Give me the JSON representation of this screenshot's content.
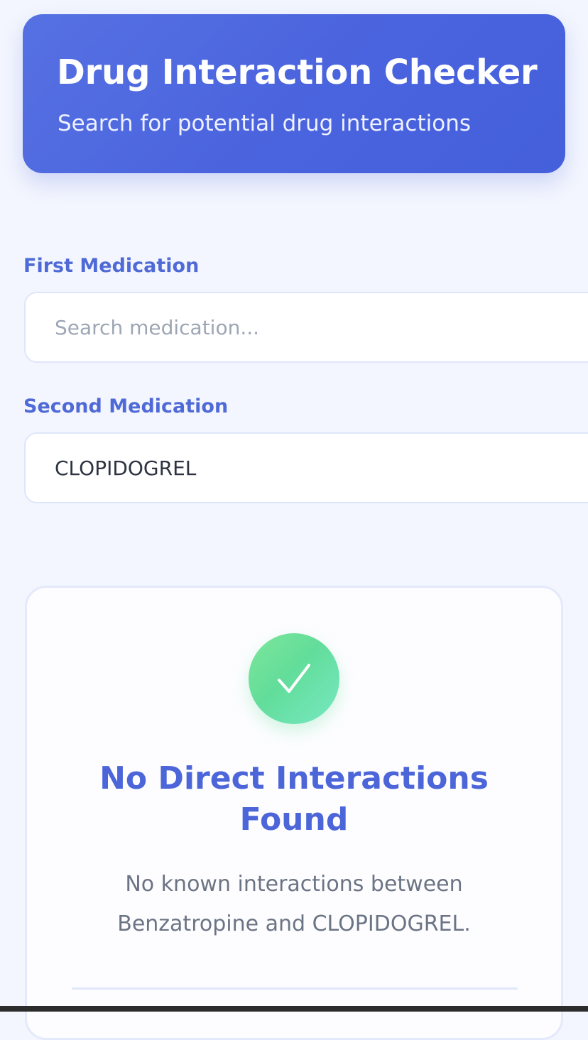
{
  "header": {
    "title": "Drug Interaction Checker",
    "subtitle": "Search for potential drug interactions"
  },
  "form": {
    "first_medication": {
      "label": "First Medication",
      "placeholder": "Search medication...",
      "value": ""
    },
    "second_medication": {
      "label": "Second Medication",
      "placeholder": "Search medication...",
      "value": "CLOPIDOGREL"
    }
  },
  "result": {
    "icon": "checkmark-icon",
    "title": "No Direct Interactions Found",
    "message": "No known interactions between Benzatropine and CLOPIDOGREL."
  },
  "colors": {
    "accent": "#4a63de",
    "label": "#4f6ad6",
    "success": "#62dd9a",
    "muted_text": "#6b7484",
    "background": "#f3f6fe"
  }
}
